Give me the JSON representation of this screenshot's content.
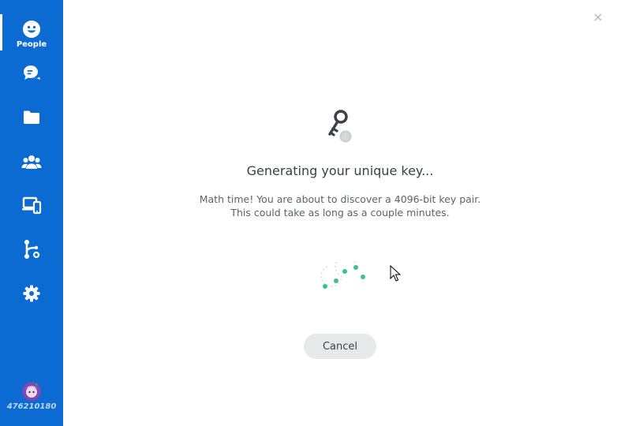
{
  "sidebar": {
    "items": [
      {
        "label": "People",
        "icon": "smiley-icon",
        "active": true
      },
      {
        "label": "",
        "icon": "chat-icon"
      },
      {
        "label": "",
        "icon": "folder-icon"
      },
      {
        "label": "",
        "icon": "team-icon"
      },
      {
        "label": "",
        "icon": "devices-icon"
      },
      {
        "label": "",
        "icon": "git-branch-icon"
      },
      {
        "label": "",
        "icon": "gear-icon"
      }
    ],
    "user_id": "476210180"
  },
  "main": {
    "title": "Generating your unique key...",
    "description_line1": "Math time! You are about to discover a 4096-bit key pair.",
    "description_line2": "This could take as long as a couple minutes.",
    "cancel_label": "Cancel",
    "close_symbol": "×"
  },
  "colors": {
    "sidebar": "#0b6bd3",
    "spinner": "#3cc28a",
    "text": "#3b4148"
  }
}
